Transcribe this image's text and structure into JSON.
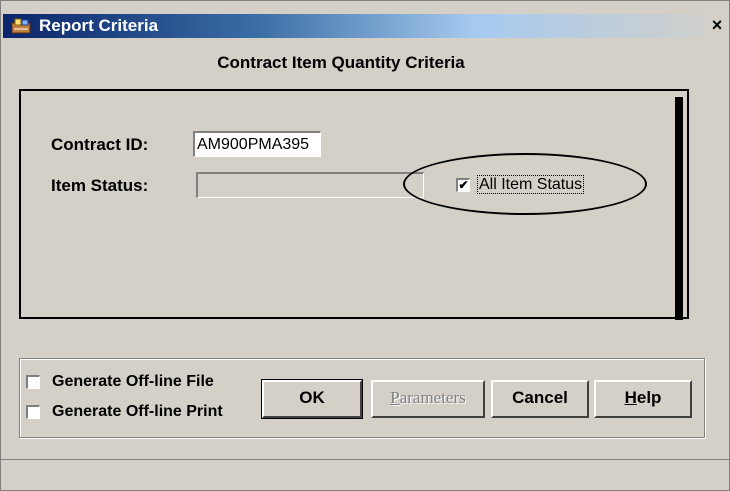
{
  "window": {
    "title": "Report Criteria",
    "close_label": "×"
  },
  "heading": "Contract Item Quantity Criteria",
  "criteria": {
    "contract_id_label": "Contract ID:",
    "contract_id_value": "AM900PMA395",
    "item_status_label": "Item Status:",
    "item_status_value": "",
    "all_item_status_label": "All Item Status",
    "all_item_status_checked": true
  },
  "options": {
    "offline_file_label": "Generate Off-line File",
    "offline_file_checked": false,
    "offline_print_label": "Generate Off-line Print",
    "offline_print_checked": false
  },
  "buttons": {
    "ok": "OK",
    "parameters_mnemonic": "P",
    "parameters_rest": "arameters",
    "cancel": "Cancel",
    "help_mnemonic": "H",
    "help_rest": "elp"
  },
  "icons": {
    "app": "report-app-icon",
    "checkmark": "✔"
  }
}
